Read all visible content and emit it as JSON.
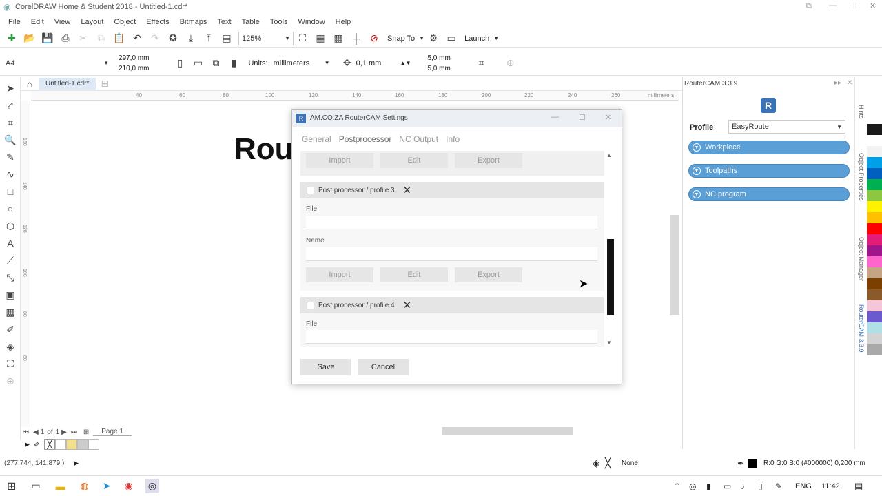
{
  "app": {
    "title": "CorelDRAW Home & Student 2018 - Untitled-1.cdr*"
  },
  "menu": [
    "File",
    "Edit",
    "View",
    "Layout",
    "Object",
    "Effects",
    "Bitmaps",
    "Text",
    "Table",
    "Tools",
    "Window",
    "Help"
  ],
  "toolbar": {
    "zoom": "125%",
    "snap_to": "Snap To",
    "launch": "Launch"
  },
  "propbar": {
    "page_size": "A4",
    "width": "297,0 mm",
    "height": "210,0 mm",
    "units_label": "Units:",
    "units_value": "millimeters",
    "nudge": "0,1 mm",
    "dup_x": "5,0 mm",
    "dup_y": "5,0 mm"
  },
  "doc_tab": {
    "label": "Untitled-1.cdr*"
  },
  "ruler": {
    "top_ticks": [
      "40",
      "60",
      "80",
      "100",
      "120",
      "140",
      "160",
      "180",
      "200",
      "220",
      "240",
      "260"
    ],
    "units": "millimeters",
    "left_ticks": [
      "160",
      "140",
      "120",
      "100",
      "80",
      "60"
    ]
  },
  "canvas": {
    "title_fragment": "Rou"
  },
  "dialog": {
    "title": "AM.CO.ZA RouterCAM Settings",
    "tabs": [
      "General",
      "Postprocessor",
      "NC Output",
      "Info"
    ],
    "active_tab": "Postprocessor",
    "buttons": {
      "import": "Import",
      "edit": "Edit",
      "export": "Export",
      "save": "Save",
      "cancel": "Cancel"
    },
    "profile3": {
      "header": "Post processor / profile 3",
      "file_label": "File",
      "name_label": "Name"
    },
    "profile4": {
      "header": "Post processor / profile 4",
      "file_label": "File"
    }
  },
  "panel": {
    "title": "RouterCAM 3.3.9",
    "profile_label": "Profile",
    "profile_value": "EasyRoute",
    "sections": [
      "Workpiece",
      "Toolpaths",
      "NC program"
    ]
  },
  "docker_tabs": [
    "Hints",
    "Object Properties",
    "Object Manager",
    "RouterCAM 3.3.9"
  ],
  "pages": {
    "current": "1",
    "of": "of",
    "total": "1",
    "page_tab": "Page 1"
  },
  "status": {
    "coords": "(277,744, 141,879 )",
    "fill": "None",
    "outline": "R:0 G:0 B:0 (#000000)  0,200 mm"
  },
  "taskbar": {
    "lang": "ENG",
    "time": "11:42"
  },
  "palette_colors": [
    "#1a1a1a",
    "#ffffff",
    "#f2f2f2",
    "#00a0e9",
    "#0060c0",
    "#00b050",
    "#8dc63f",
    "#fff200",
    "#ffc000",
    "#ff0000",
    "#e31c79",
    "#a0148c",
    "#ff66cc",
    "#c4a484",
    "#7b3f00",
    "#8b5a2b",
    "#f4c6d7",
    "#6a5acd",
    "#b0e0e6",
    "#d3d3d3",
    "#a9a9a9",
    "#ffffff"
  ],
  "bottom_swatches": [
    "#ffffff",
    "#f2e08c",
    "#cccccc",
    "#ffffff"
  ]
}
